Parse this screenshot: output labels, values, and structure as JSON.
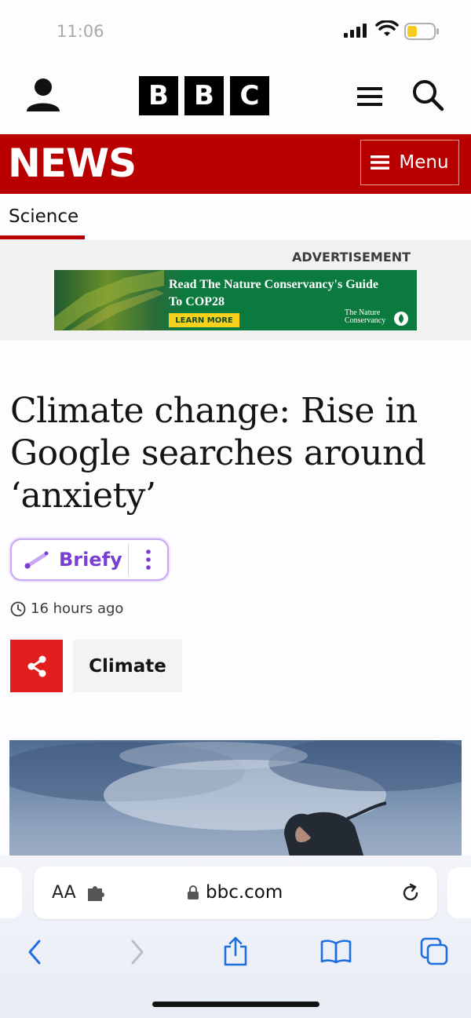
{
  "status_bar": {
    "time": "11:06"
  },
  "header": {
    "logo_letters": [
      "B",
      "B",
      "C"
    ]
  },
  "news_bar": {
    "title": "NEWS",
    "menu_label": "Menu",
    "color": "#b80000"
  },
  "section_nav": {
    "active": "Science"
  },
  "advertisement": {
    "label": "ADVERTISEMENT",
    "headline": "Read The Nature Conservancy's Guide To COP28",
    "cta": "LEARN MORE",
    "logo_text_line1": "The Nature",
    "logo_text_line2": "Conservancy"
  },
  "article": {
    "headline": "Climate change: Rise in Google searches around ‘anxiety’",
    "briefy_label": "Briefy",
    "timestamp": "16 hours ago",
    "topic": "Climate"
  },
  "browser": {
    "aa_label": "AA",
    "url": "bbc.com"
  },
  "colors": {
    "share_red": "#e11d1d",
    "briefy_purple": "#7a3fd1",
    "ios_blue": "#1f6fe0"
  }
}
